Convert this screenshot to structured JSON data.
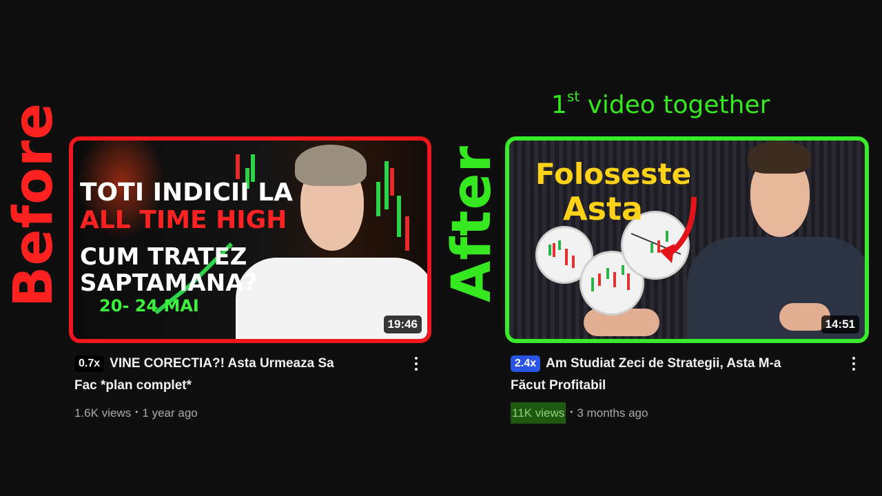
{
  "labels": {
    "before": "Before",
    "after": "After",
    "headline_num": "1",
    "headline_sup": "st",
    "headline_rest": "video together"
  },
  "videos": [
    {
      "thumbnail_text": [
        "TOTI INDICII LA",
        "ALL TIME HIGH",
        "CUM TRATEZ",
        "SAPTAMANA?",
        "20- 24 MAI"
      ],
      "duration": "19:46",
      "badge": "0.7x",
      "title_line1": "VINE CORECTIA?! Asta Urmeaza Sa",
      "title_line2": "Fac *plan complet*",
      "views": "1.6K views",
      "age": "1 year ago",
      "frame_color": "#f0161d",
      "badge_color": "#000000"
    },
    {
      "thumbnail_text": [
        "Foloseste",
        "Asta"
      ],
      "duration": "14:51",
      "badge": "2.4x",
      "title_line1": "Am Studiat Zeci de Strategii, Asta M-a",
      "title_line2": "Făcut Profitabil",
      "views": "11K views",
      "age": "3 months ago",
      "frame_color": "#38ec2b",
      "badge_color": "#2a55e4"
    }
  ],
  "icons": {
    "menu": "more-vert-icon"
  }
}
